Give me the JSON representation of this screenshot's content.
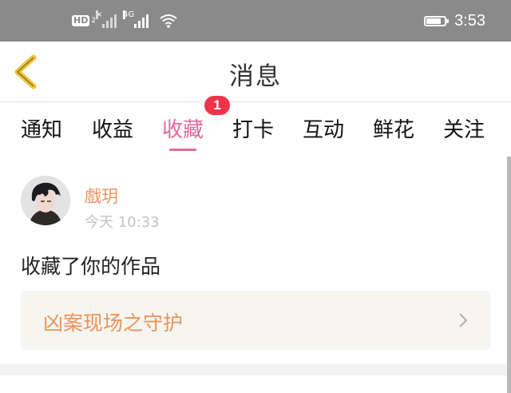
{
  "status_bar": {
    "network_badge": "HD",
    "sim_number": "2",
    "network_type": "4G",
    "time": "3:53",
    "battery_level": 0.8
  },
  "header": {
    "title": "消息",
    "back_icon": "chevron-left-icon",
    "back_color": "#f0c23a"
  },
  "tabs": {
    "items": [
      {
        "label": "通知"
      },
      {
        "label": "收益"
      },
      {
        "label": "收藏",
        "active": true,
        "badge": "1"
      },
      {
        "label": "打卡"
      },
      {
        "label": "互动"
      },
      {
        "label": "鲜花"
      },
      {
        "label": "关注"
      }
    ],
    "active_color": "#e6679d"
  },
  "notification": {
    "username": "戲玥",
    "timestamp": "今天 10:33",
    "message": "收藏了你的作品",
    "work_title": "凶案现场之守护",
    "accent_color": "#e8945d"
  }
}
